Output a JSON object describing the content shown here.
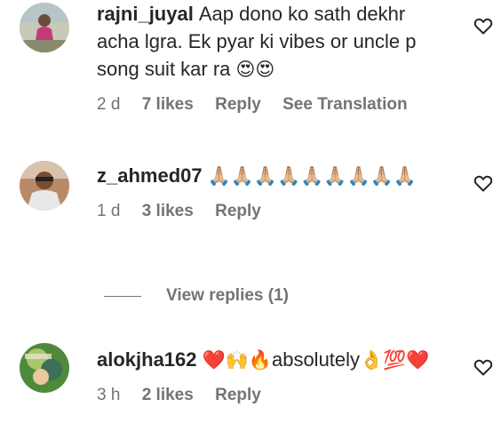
{
  "comments": [
    {
      "username": "rajni_juyal",
      "text": "Aap dono ko sath dekhr acha lgra. Ek pyar ki vibes or uncle p song suit kar ra",
      "emojis": "😍😍",
      "time": "2 d",
      "likes": "7 likes",
      "reply": "Reply",
      "translate": "See Translation"
    },
    {
      "username": "z_ahmed07",
      "text": "",
      "emojis": "🙏🏼🙏🏼🙏🏼🙏🏼🙏🏼🙏🏼🙏🏼🙏🏼🙏🏼",
      "time": "1 d",
      "likes": "3 likes",
      "reply": "Reply",
      "view_replies": "View replies (1)"
    },
    {
      "username": "alokjha162",
      "text": "absolutely",
      "emojis_before": "❤️🙌🔥",
      "emojis_after": "👌💯❤️",
      "time": "3 h",
      "likes": "2 likes",
      "reply": "Reply"
    }
  ],
  "icons": {
    "like": "heart-outline-icon"
  },
  "colors": {
    "text": "#262626",
    "secondary": "#737373"
  }
}
